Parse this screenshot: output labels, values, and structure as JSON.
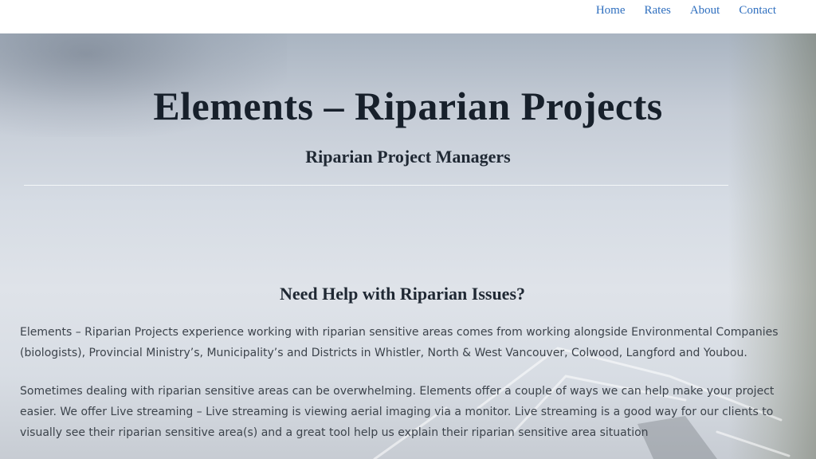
{
  "nav": {
    "items": [
      {
        "label": "Home"
      },
      {
        "label": "Rates"
      },
      {
        "label": "About"
      },
      {
        "label": "Contact"
      }
    ]
  },
  "hero": {
    "title": "Elements – Riparian Projects",
    "subtitle": "Riparian Project Managers"
  },
  "content": {
    "heading": "Need Help with Riparian Issues?",
    "paragraphs": [
      "Elements – Riparian Projects experience working with riparian sensitive areas comes from working alongside Environmental Companies (biologists), Provincial Ministry’s, Municipality’s and Districts in Whistler, North & West Vancouver, Colwood, Langford and Youbou.",
      "Sometimes dealing with riparian sensitive areas can be overwhelming. Elements offer a couple of ways we can help make your project easier. We offer Live streaming – Live streaming is viewing aerial imaging via a monitor. Live streaming is a good way for our clients to visually see their riparian sensitive area(s) and a great tool help us explain their riparian sensitive area situation"
    ]
  },
  "colors": {
    "nav_link": "#2f6fbf",
    "title_text": "#17202b",
    "body_text": "#3c434b"
  }
}
